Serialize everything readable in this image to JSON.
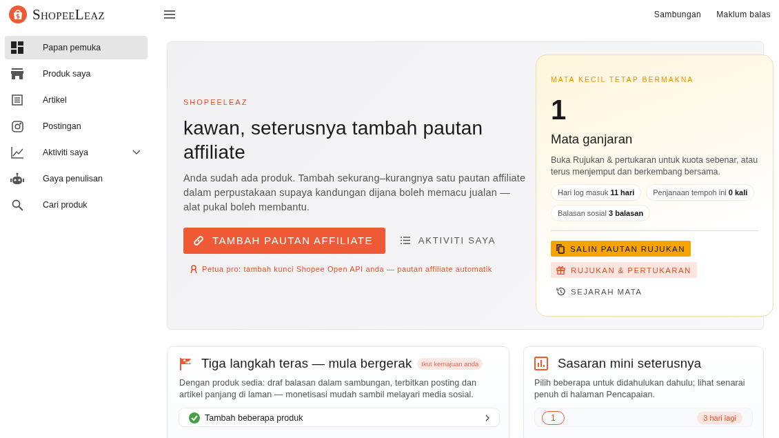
{
  "brand": {
    "name": "ShopeeLeaz"
  },
  "topbar": {
    "links": [
      "Sambungan",
      "Maklum balas"
    ]
  },
  "sidebar": {
    "items": [
      {
        "label": "Papan pemuka",
        "kind": "dashboard",
        "selected": true
      },
      {
        "label": "Produk saya",
        "kind": "store",
        "selected": false
      },
      {
        "label": "Artikel",
        "kind": "article",
        "selected": false
      },
      {
        "label": "Postingan",
        "kind": "camera",
        "selected": false
      },
      {
        "label": "Aktiviti saya",
        "kind": "chart",
        "selected": false,
        "expanded": false
      },
      {
        "label": "Gaya penulisan",
        "kind": "robot",
        "selected": false
      },
      {
        "label": "Cari produk",
        "kind": "search",
        "selected": false
      }
    ]
  },
  "hero": {
    "eyebrow": "SHOPEELEAZ",
    "title": "kawan, seterusnya tambah pautan affiliate",
    "description": "Anda sudah ada produk. Tambah sekurang–kurangnya satu pautan affiliate dalam perpustakaan supaya kandungan dijana boleh memacu jualan — alat pukal boleh membantu.",
    "primary_button": "TAMBAH PAUTAN AFFILIATE",
    "secondary_button": "AKTIVITI SAYA",
    "tip": "Petua pro: tambah kunci Shopee Open API anda — pautan affiliate automatik"
  },
  "points_card": {
    "eyebrow": "MATA KECIL TETAP BERMAKNA",
    "value": "1",
    "label": "Mata ganjaran",
    "description": "Buka Rujukan & pertukaran untuk kuota sebenar, atau terus menjemput dan berkembang bersama.",
    "stats": [
      "Hari log masuk **11 hari**",
      "Penjanaan tempoh ini **0 kali**",
      "Balasan sosial **3 balasan**"
    ],
    "buttons": [
      {
        "label": "SALIN PAUTAN RUJUKAN",
        "kind": "primary"
      },
      {
        "label": "RUJUKAN & PERTUKARAN",
        "kind": "soft"
      },
      {
        "label": "SEJARAH MATA",
        "kind": "text"
      }
    ]
  },
  "steps_card": {
    "title": "Tiga langkah teras — mula bergerak",
    "badge": "Ikut kemajuan anda",
    "description": "Dengan produk sedia: draf balasan dalam sambungan, terbitkan posting dan artikel panjang di laman — monetisasi mudah sambil melayari media sosial.",
    "items": [
      {
        "label": "Tambah beberapa produk",
        "done": true
      }
    ]
  },
  "goals_card": {
    "title": "Sasaran mini seterusnya",
    "description": "Pilih beberapa untuk didahulukan dahulu; lihat senarai penuh di halaman Pencapaian.",
    "items": [
      {
        "number": "1",
        "badge": "3 hari lagi"
      }
    ]
  }
}
